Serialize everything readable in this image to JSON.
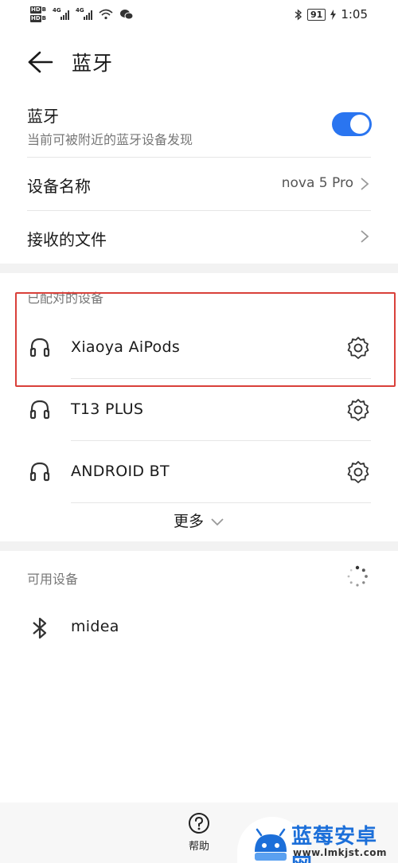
{
  "status_bar": {
    "hd_1": "HD",
    "hd_1_sub": "B",
    "hd_2": "HD",
    "hd_2_sub": "B",
    "net_1": "4G",
    "net_2": "4G",
    "battery": "91",
    "time": "1:05"
  },
  "header": {
    "title": "蓝牙"
  },
  "bluetooth": {
    "label": "蓝牙",
    "description": "当前可被附近的蓝牙设备发现",
    "enabled": true,
    "accent_color": "#2a75f0"
  },
  "device_name": {
    "label": "设备名称",
    "value": "nova 5 Pro"
  },
  "received_files": {
    "label": "接收的文件"
  },
  "paired": {
    "header": "已配对的设备",
    "devices": [
      {
        "name": "Xiaoya AiPods",
        "icon": "headset-icon"
      },
      {
        "name": "T13 PLUS",
        "icon": "headset-icon"
      },
      {
        "name": "ANDROID BT",
        "icon": "headset-icon"
      }
    ],
    "more_label": "更多",
    "highlight_color": "#d9403a"
  },
  "available": {
    "header": "可用设备",
    "devices": [
      {
        "name": "midea",
        "icon": "bluetooth-icon"
      }
    ]
  },
  "bottom": {
    "help_label": "帮助"
  },
  "watermark": {
    "brand": "蓝莓安卓网",
    "url": "www.lmkjst.com"
  }
}
